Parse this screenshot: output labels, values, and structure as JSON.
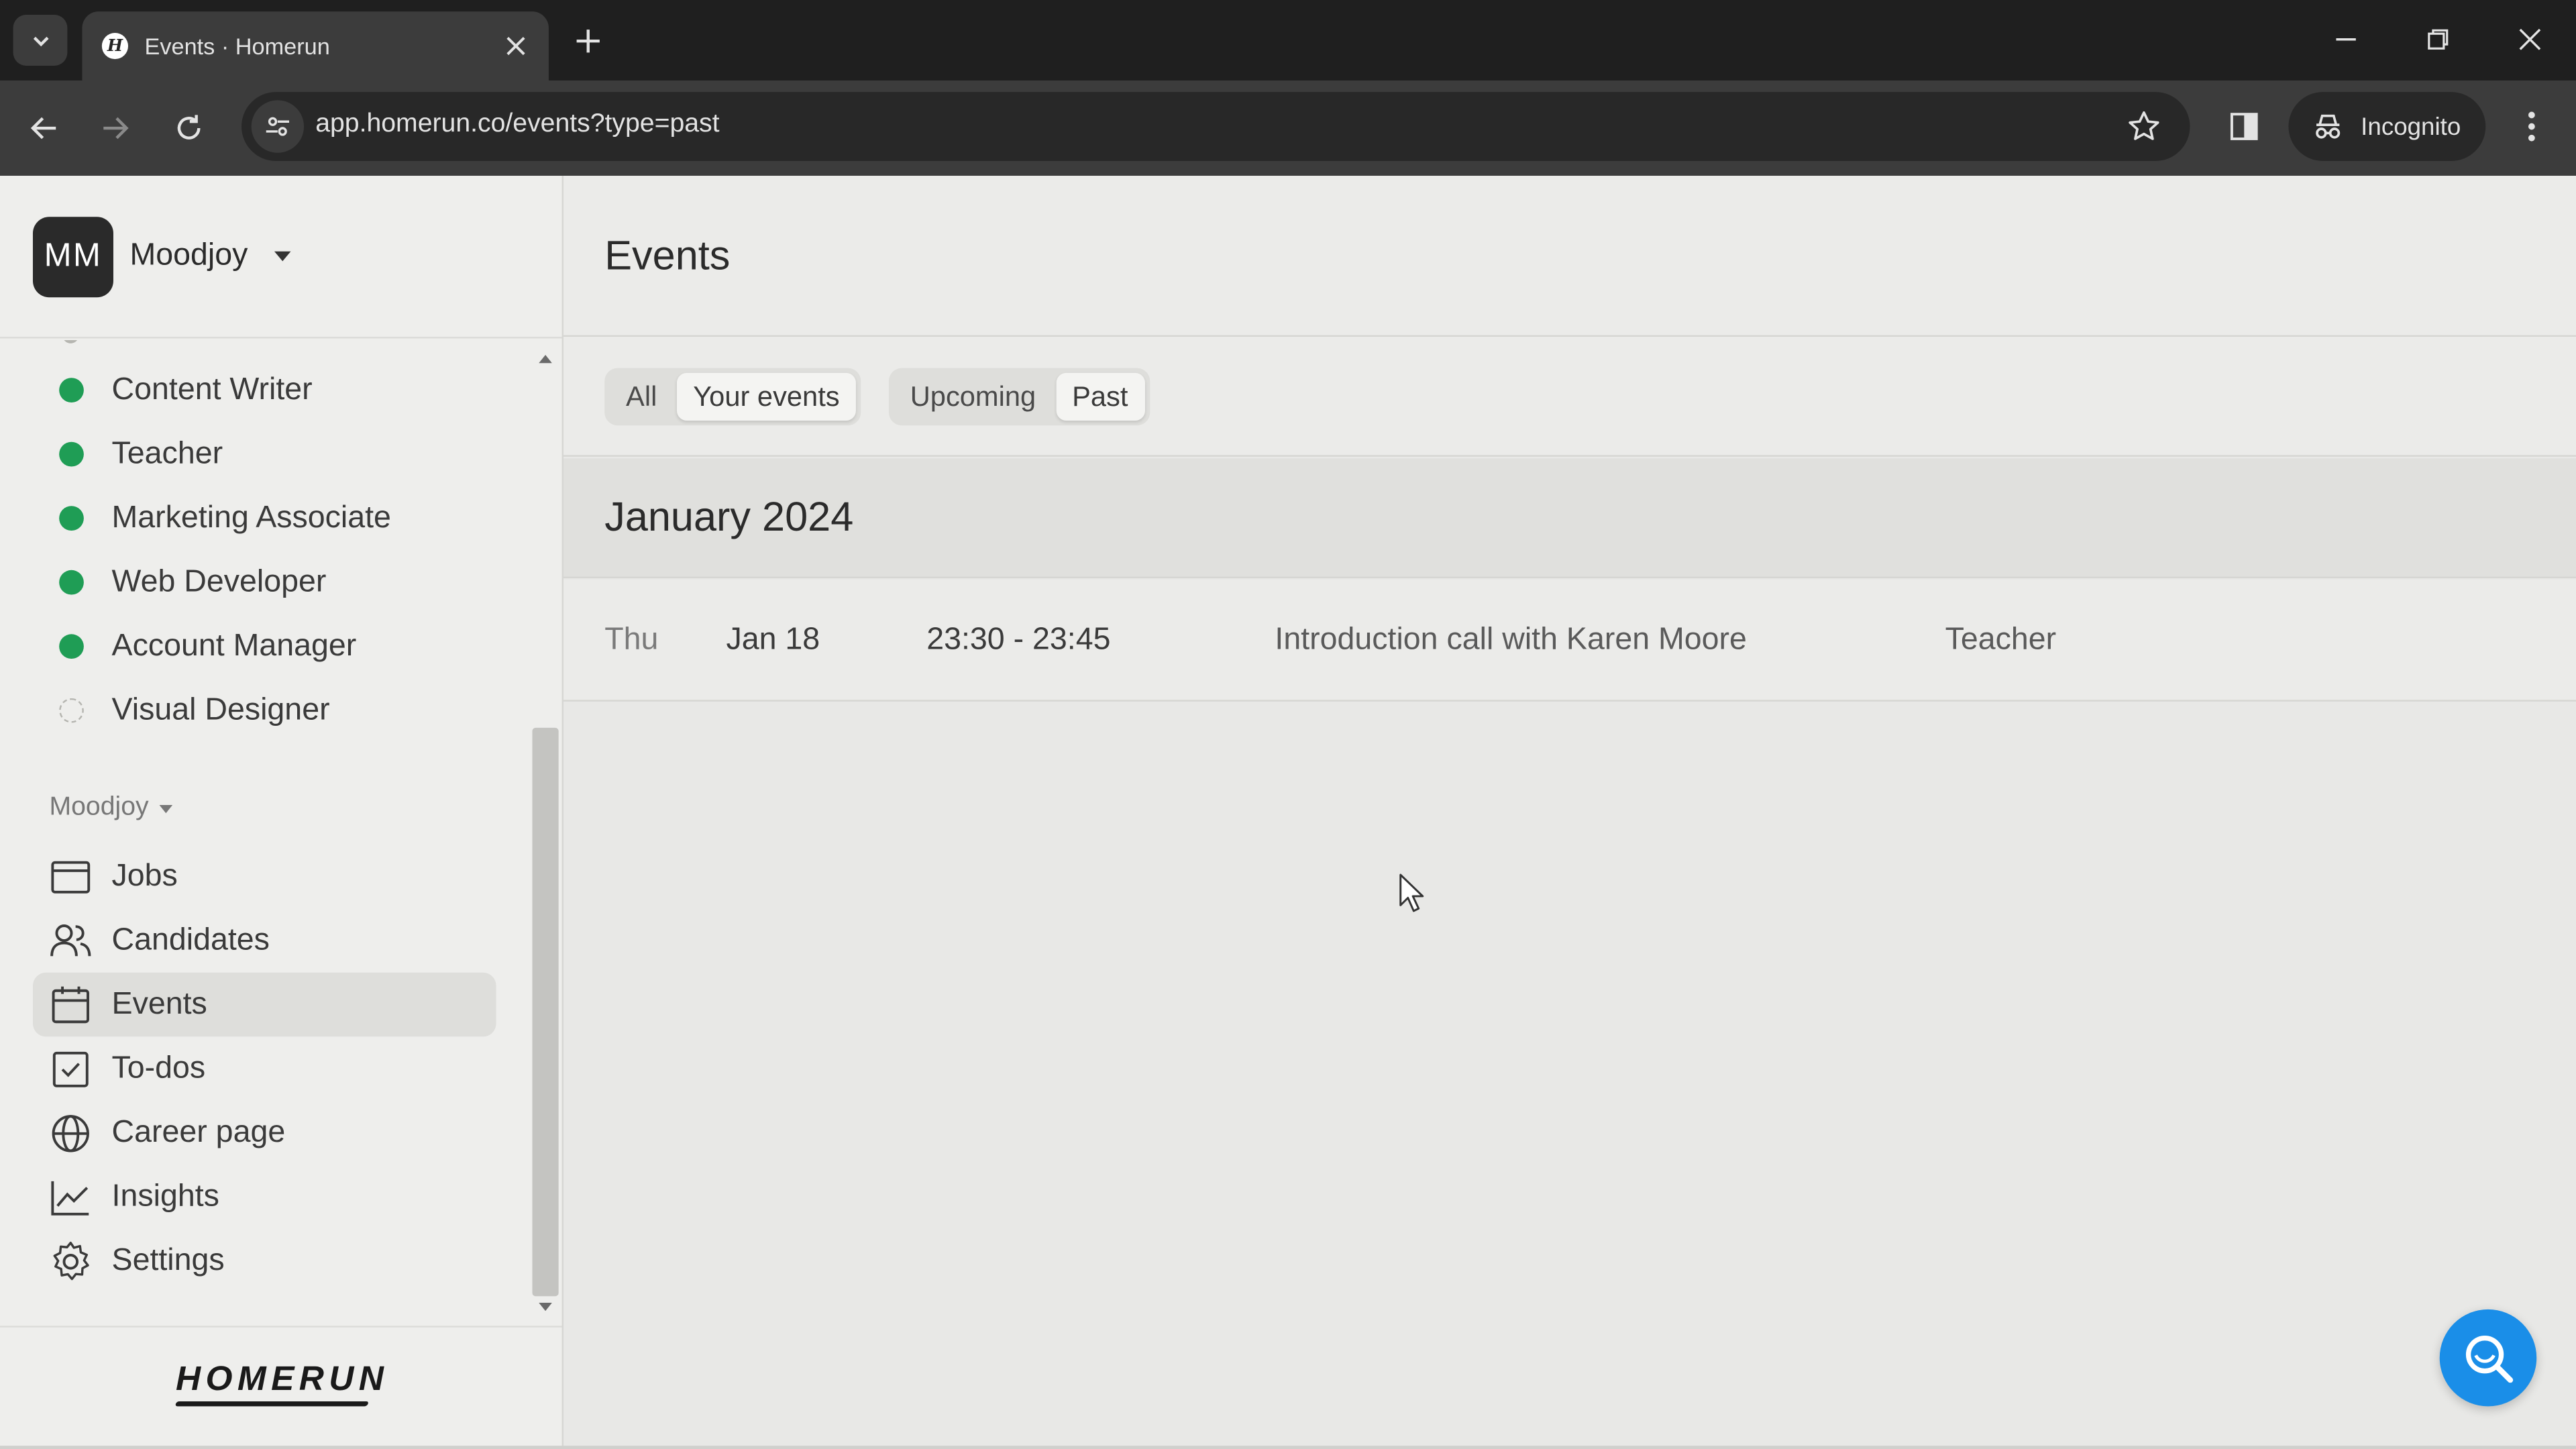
{
  "browser": {
    "tab_title": "Events · Homerun",
    "url": "app.homerun.co/events?type=past",
    "incognito_label": "Incognito"
  },
  "workspace": {
    "initials": "MM",
    "name": "Moodjoy"
  },
  "jobs": [
    {
      "label": "Content Writer",
      "status": "published"
    },
    {
      "label": "Teacher",
      "status": "published"
    },
    {
      "label": "Marketing Associate",
      "status": "published"
    },
    {
      "label": "Web Developer",
      "status": "published"
    },
    {
      "label": "Account Manager",
      "status": "published"
    },
    {
      "label": "Visual Designer",
      "status": "draft"
    }
  ],
  "nav": {
    "section_label": "Moodjoy",
    "items": [
      {
        "label": "Jobs",
        "icon": "briefcase-icon"
      },
      {
        "label": "Candidates",
        "icon": "users-icon"
      },
      {
        "label": "Events",
        "icon": "calendar-icon",
        "active": true
      },
      {
        "label": "To-dos",
        "icon": "checkbox-icon"
      },
      {
        "label": "Career page",
        "icon": "globe-icon"
      },
      {
        "label": "Insights",
        "icon": "chart-icon"
      },
      {
        "label": "Settings",
        "icon": "gear-icon"
      }
    ]
  },
  "brand": {
    "logo_text": "HOMERUN"
  },
  "page": {
    "title": "Events",
    "filters": {
      "scope": [
        {
          "label": "All"
        },
        {
          "label": "Your events",
          "selected": true
        }
      ],
      "time": [
        {
          "label": "Upcoming"
        },
        {
          "label": "Past",
          "selected": true
        }
      ]
    },
    "month": "January 2024",
    "events": [
      {
        "day": "Thu",
        "date": "Jan 18",
        "time": "23:30 - 23:45",
        "title": "Introduction call with Karen Moore",
        "job": "Teacher"
      }
    ]
  },
  "colors": {
    "published_dot": "#1f9d55",
    "fab": "#1a8ee8"
  }
}
